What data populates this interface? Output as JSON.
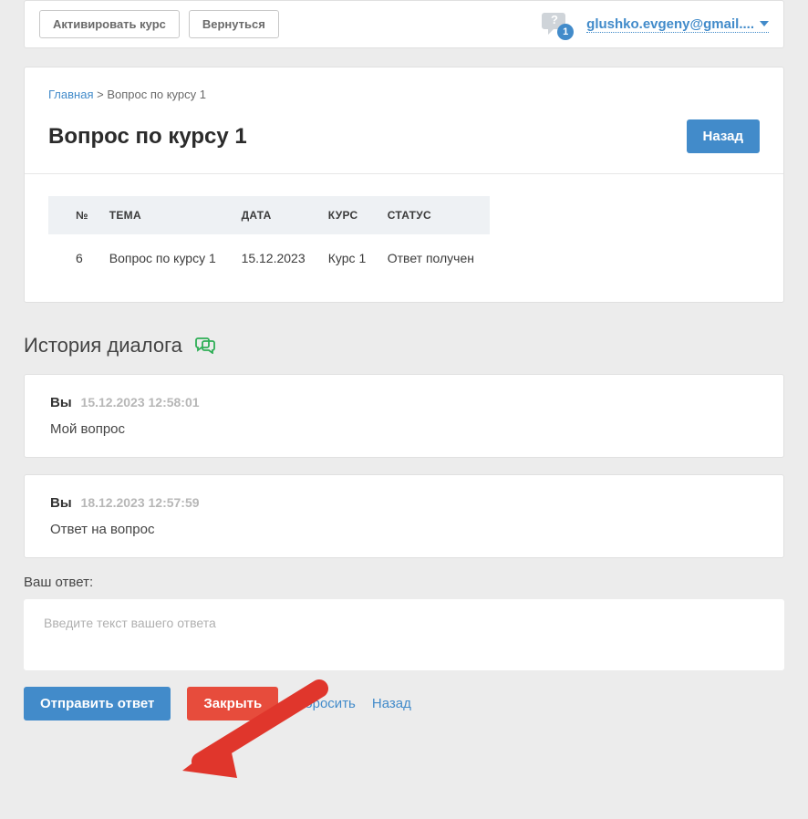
{
  "topbar": {
    "activate_label": "Активировать курс",
    "back_label": "Вернуться",
    "notif_count": "1",
    "user_email": "glushko.evgeny@gmail...."
  },
  "breadcrumb": {
    "home": "Главная",
    "current": "Вопрос по курсу 1"
  },
  "page": {
    "title": "Вопрос по курсу 1",
    "back_btn": "Назад"
  },
  "table": {
    "headers": {
      "num": "№",
      "topic": "ТЕМА",
      "date": "ДАТА",
      "course": "КУРС",
      "status": "СТАТУС"
    },
    "row": {
      "num": "6",
      "topic": "Вопрос по курсу 1",
      "date": "15.12.2023",
      "course": "Курс 1",
      "status": "Ответ получен"
    }
  },
  "history": {
    "title": "История диалога"
  },
  "messages": [
    {
      "author": "Вы",
      "ts": "15.12.2023 12:58:01",
      "body": "Мой вопрос"
    },
    {
      "author": "Вы",
      "ts": "18.12.2023 12:57:59",
      "body": "Ответ на вопрос"
    }
  ],
  "reply": {
    "label": "Ваш ответ:",
    "placeholder": "Введите текст вашего ответа"
  },
  "actions": {
    "send": "Отправить ответ",
    "close": "Закрыть",
    "reset": "Сбросить",
    "back": "Назад"
  }
}
